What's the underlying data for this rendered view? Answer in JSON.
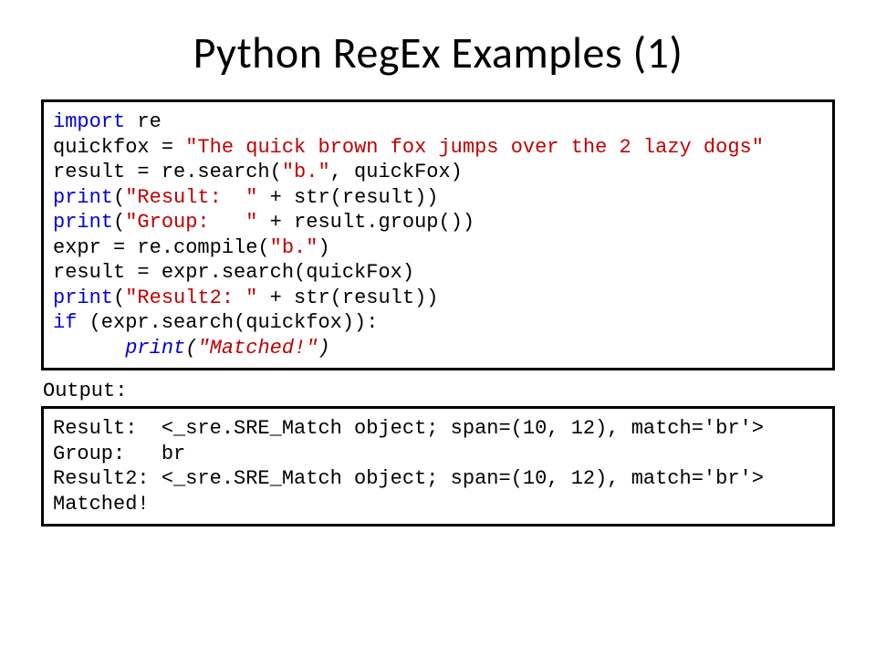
{
  "title": "Python RegEx Examples (1)",
  "code": {
    "l1_kw": "import",
    "l1_rest": " re",
    "blank1": "",
    "l2a": "quickfox = ",
    "l2b": "\"The quick brown fox jumps over the 2 lazy dogs\"",
    "l3a": "result = re.search(",
    "l3b": "\"b.\"",
    "l3c": ", quickFox)",
    "l4a": "print",
    "l4b": "(",
    "l4c": "\"Result:  \"",
    "l4d": " + str(result))",
    "l5a": "print",
    "l5b": "(",
    "l5c": "\"Group:   \"",
    "l5d": " + result.group())",
    "l6a": "expr = re.compile(",
    "l6b": "\"b.\"",
    "l6c": ")",
    "l7": "result = expr.search(quickFox)",
    "l8a": "print",
    "l8b": "(",
    "l8c": "\"Result2: \"",
    "l8d": " + str(result))",
    "l9a": "if",
    "l9b": " (expr.search(quickfox)):",
    "l10pad": "      ",
    "l10a": "print",
    "l10b": "(",
    "l10c": "\"Matched!\"",
    "l10d": ")"
  },
  "output_label": "Output:",
  "output": {
    "line1": "Result:  <_sre.SRE_Match object; span=(10, 12), match='br'>",
    "line2": "Group:   br",
    "line3": "Result2: <_sre.SRE_Match object; span=(10, 12), match='br'>",
    "line4": "Matched!"
  }
}
